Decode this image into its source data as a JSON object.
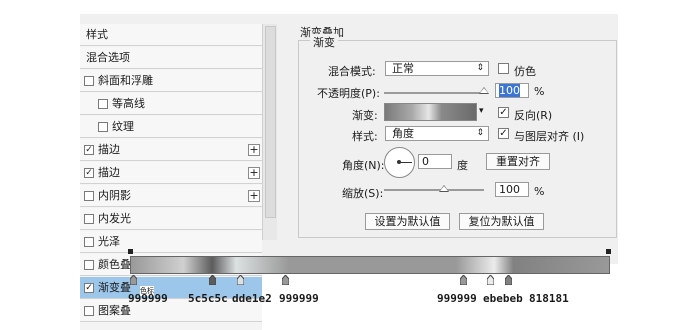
{
  "style_list": {
    "items": [
      {
        "label": "样式",
        "checkbox": false,
        "checked": false,
        "plus": false
      },
      {
        "label": "混合选项",
        "checkbox": false,
        "checked": false,
        "plus": false
      },
      {
        "label": "斜面和浮雕",
        "checkbox": true,
        "checked": false,
        "plus": false
      },
      {
        "label": "等高线",
        "checkbox": true,
        "checked": false,
        "plus": false
      },
      {
        "label": "纹理",
        "checkbox": true,
        "checked": false,
        "plus": false
      },
      {
        "label": "描边",
        "checkbox": true,
        "checked": true,
        "plus": true
      },
      {
        "label": "描边",
        "checkbox": true,
        "checked": true,
        "plus": true
      },
      {
        "label": "内阴影",
        "checkbox": true,
        "checked": false,
        "plus": true
      },
      {
        "label": "内发光",
        "checkbox": true,
        "checked": false,
        "plus": false
      },
      {
        "label": "光泽",
        "checkbox": true,
        "checked": false,
        "plus": false
      },
      {
        "label": "颜色叠",
        "checkbox": true,
        "checked": false,
        "plus": false
      },
      {
        "label": "渐变叠",
        "checkbox": true,
        "checked": true,
        "plus": false
      },
      {
        "label": "图案叠",
        "checkbox": true,
        "checked": false,
        "plus": false
      }
    ]
  },
  "gradient_overlay": {
    "section_title": "渐变叠加",
    "group_title": "渐变",
    "blend_mode_label": "混合模式:",
    "blend_mode_value": "正常",
    "dither_label": "仿色",
    "opacity_label": "不透明度(P):",
    "opacity_value": "100",
    "opacity_unit": "%",
    "opacity_level": 100,
    "gradient_label": "渐变:",
    "reverse_label": "反向(R)",
    "style_label": "样式:",
    "style_value": "角度",
    "align_label": "与图层对齐 (I)",
    "angle_label": "角度(N):",
    "angle_value": "0",
    "angle_unit": "度",
    "reset_align_label": "重置对齐",
    "scale_label": "缩放(S):",
    "scale_value": "100",
    "scale_unit": "%",
    "scale_level": 100,
    "set_default_label": "设置为默认值",
    "reset_default_label": "复位为默认值"
  },
  "gradient_editor": {
    "stops_codes": [
      "999999",
      "5c5c5c",
      "dde1e2",
      "999999",
      "999999",
      "ebebeb",
      "818181"
    ],
    "stops_label": "色标"
  }
}
